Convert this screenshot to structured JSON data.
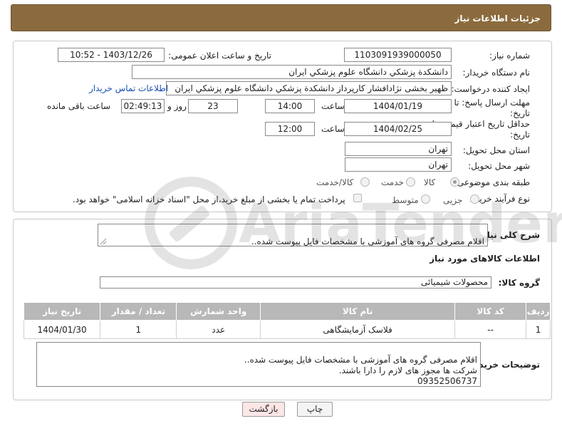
{
  "header": {
    "title": "جزئیات اطلاعات نیاز"
  },
  "form": {
    "need_number": {
      "label": "شماره نیاز:",
      "value": "1103091939000050"
    },
    "announce_datetime": {
      "label": "تاریخ و ساعت اعلان عمومی:",
      "value": "1403/12/26 - 10:52"
    },
    "buyer_org": {
      "label": "نام دستگاه خریدار:",
      "value": "دانشکدة پزشكي دانشگاه علوم پزشكي ايران"
    },
    "requester": {
      "label": "ایجاد کننده درخواست:",
      "value": "ظهیر بخشی نژادافشار کارپرداز دانشکدة پزشكي دانشگاه علوم پزشكي ايران",
      "contact_link": "اطلاعات تماس خریدار"
    },
    "reply_deadline": {
      "label_line1": "مهلت ارسال پاسخ: تا",
      "label_line2": "تاریخ:",
      "date": "1404/01/19",
      "time_label": "ساعت",
      "time": "14:00",
      "days": "23",
      "days_label": "روز و",
      "remaining": "02:49:13",
      "remaining_label": "ساعت باقی مانده"
    },
    "price_validity": {
      "label_line1": "حداقل تاریخ اعتبار قیمت: تا",
      "label_line2": "تاریخ:",
      "date": "1404/02/25",
      "time_label": "ساعت",
      "time": "12:00"
    },
    "province": {
      "label": "استان محل تحویل:",
      "value": "تهران"
    },
    "city": {
      "label": "شهر محل تحویل:",
      "value": "تهران"
    },
    "category": {
      "label": "طبقه بندی موضوعی:",
      "options": [
        "کالا",
        "خدمت",
        "کالا/خدمت"
      ],
      "selected": "کالا"
    },
    "purchase_type": {
      "label": "نوع فرآیند خرید :",
      "options": [
        "جزیی",
        "متوسط"
      ],
      "selected": "جزیی",
      "payment_note": "پرداخت تمام یا بخشی از مبلغ خرید،از محل \"اسناد خزانه اسلامی\" خواهد بود."
    }
  },
  "summary": {
    "general_desc_label": "شرح کلی نیاز:",
    "general_desc": "اقلام مصرفی گروه های آموزشی با مشخصات فایل پیوست شده..",
    "goods_info_title": "اطلاعات کالاهای مورد نیاز",
    "goods_group_label": "گروه کالا:",
    "goods_group": "محصولات شیمیائی"
  },
  "table": {
    "headers": [
      "ردیف",
      "کد کالا",
      "نام کالا",
      "واحد شمارش",
      "تعداد / مقدار",
      "تاریخ نیاز"
    ],
    "rows": [
      {
        "row": "1",
        "code": "--",
        "name": "فلاسک آزمایشگاهی",
        "unit": "عدد",
        "qty": "1",
        "date": "1404/01/30"
      }
    ]
  },
  "buyer_notes": {
    "label": "توضیحات خریدار:",
    "text": "اقلام مصرفی گروه های آموزشی با مشخصات فایل پیوست شده..\nشرکت ها مجوز های لازم را دارا باشند.\n09352506737"
  },
  "buttons": {
    "print": "چاپ",
    "back": "بازگشت"
  },
  "watermark": {
    "text": "AriaTender.neT"
  }
}
